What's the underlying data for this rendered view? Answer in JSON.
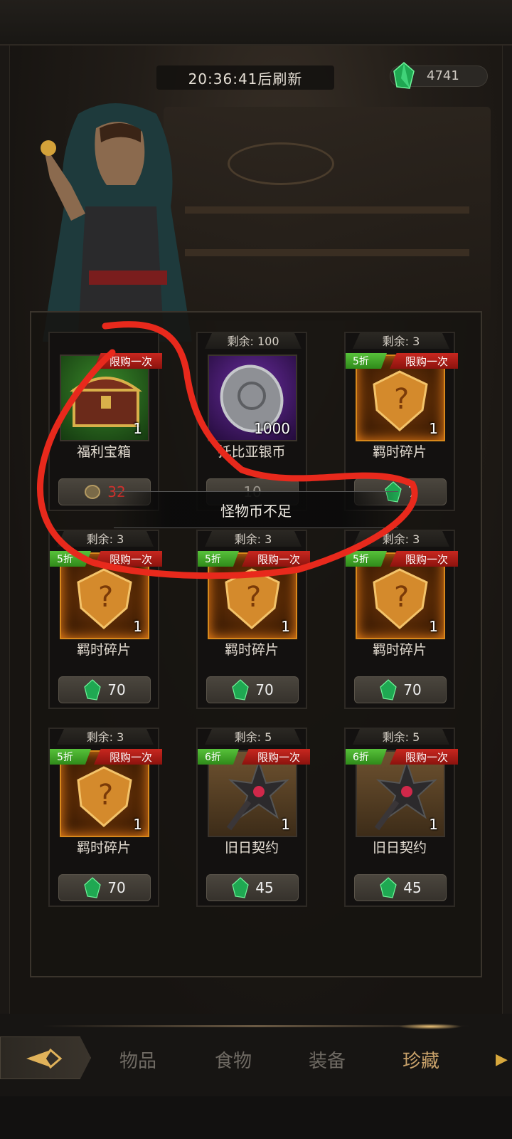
{
  "header": {
    "refresh_timer": "20:36:41后刷新",
    "gem_balance": "4741"
  },
  "items": [
    {
      "remaining": "",
      "name": "福利宝箱",
      "qty": "1",
      "price": "32",
      "price_state": "insufficient",
      "discount": "",
      "limit": "限购一次",
      "icon": "treasure-chest-icon",
      "bg": "green"
    },
    {
      "remaining": "剩余: 100",
      "name": "托比亚银币",
      "qty": "1000",
      "price": "10",
      "price_state": "dim",
      "discount": "",
      "limit": "",
      "icon": "silver-coin-icon",
      "bg": "purple"
    },
    {
      "remaining": "剩余: 3",
      "name": "羁时碎片",
      "qty": "1",
      "price": "7",
      "price_state": "normal",
      "discount": "5折",
      "limit": "限购一次",
      "icon": "puzzle-shard-icon",
      "bg": "orange"
    },
    {
      "remaining": "剩余: 3",
      "name": "羁时碎片",
      "qty": "1",
      "price": "70",
      "price_state": "normal",
      "discount": "5折",
      "limit": "限购一次",
      "icon": "puzzle-shard-icon",
      "bg": "orange"
    },
    {
      "remaining": "剩余: 3",
      "name": "羁时碎片",
      "qty": "1",
      "price": "70",
      "price_state": "normal",
      "discount": "5折",
      "limit": "限购一次",
      "icon": "puzzle-shard-icon",
      "bg": "orange"
    },
    {
      "remaining": "剩余: 3",
      "name": "羁时碎片",
      "qty": "1",
      "price": "70",
      "price_state": "normal",
      "discount": "5折",
      "limit": "限购一次",
      "icon": "puzzle-shard-icon",
      "bg": "orange"
    },
    {
      "remaining": "剩余: 3",
      "name": "羁时碎片",
      "qty": "1",
      "price": "70",
      "price_state": "normal",
      "discount": "5折",
      "limit": "限购一次",
      "icon": "puzzle-shard-icon",
      "bg": "orange"
    },
    {
      "remaining": "剩余: 5",
      "name": "旧日契约",
      "qty": "1",
      "price": "45",
      "price_state": "normal",
      "discount": "6折",
      "limit": "限购一次",
      "icon": "dark-shuriken-icon",
      "bg": "brown"
    },
    {
      "remaining": "剩余: 5",
      "name": "旧日契约",
      "qty": "1",
      "price": "45",
      "price_state": "normal",
      "discount": "6折",
      "limit": "限购一次",
      "icon": "dark-shuriken-icon",
      "bg": "brown"
    }
  ],
  "toast": "怪物币不足",
  "tabs": {
    "items": "物品",
    "food": "食物",
    "equipment": "装备",
    "collection": "珍藏"
  },
  "colors": {
    "gem": "#2fd36b",
    "discount": "#3fa624",
    "limit": "#b51d16",
    "active_tab": "#c9a26a",
    "annotation": "#e8291c"
  }
}
